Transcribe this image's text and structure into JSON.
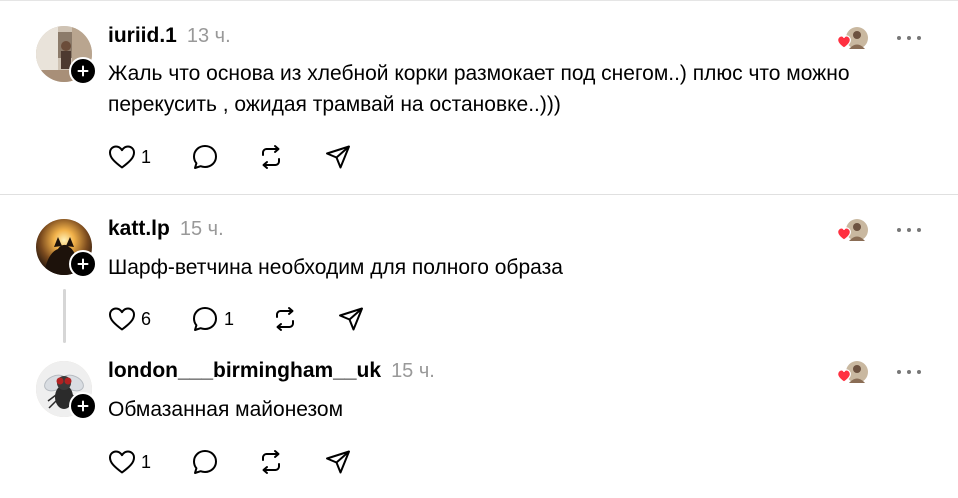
{
  "comments": [
    {
      "username": "iuriid.1",
      "time": "13 ч.",
      "text": "Жаль что основа из хлебной корки размокает под снегом..) плюс что можно перекусить , ожидая трамвай на остановке..)))",
      "likes": "1",
      "replies": ""
    },
    {
      "username": "katt.lp",
      "time": "15 ч.",
      "text": "Шарф-ветчина необходим для полного образа",
      "likes": "6",
      "replies": "1"
    },
    {
      "username": "london___birmingham__uk",
      "time": "15 ч.",
      "text": "Обмазанная майонезом",
      "likes": "1",
      "replies": ""
    }
  ],
  "icons": {
    "like": "heart-outline-icon",
    "reply": "speech-bubble-icon",
    "repost": "repost-icon",
    "share": "send-icon",
    "more": "more-dots-icon",
    "follow": "plus-icon",
    "reaction": "liked-by-author-icon"
  },
  "colors": {
    "text": "#000000",
    "muted": "#999999",
    "heart": "#ff3040",
    "divider": "#e0e0e0"
  }
}
